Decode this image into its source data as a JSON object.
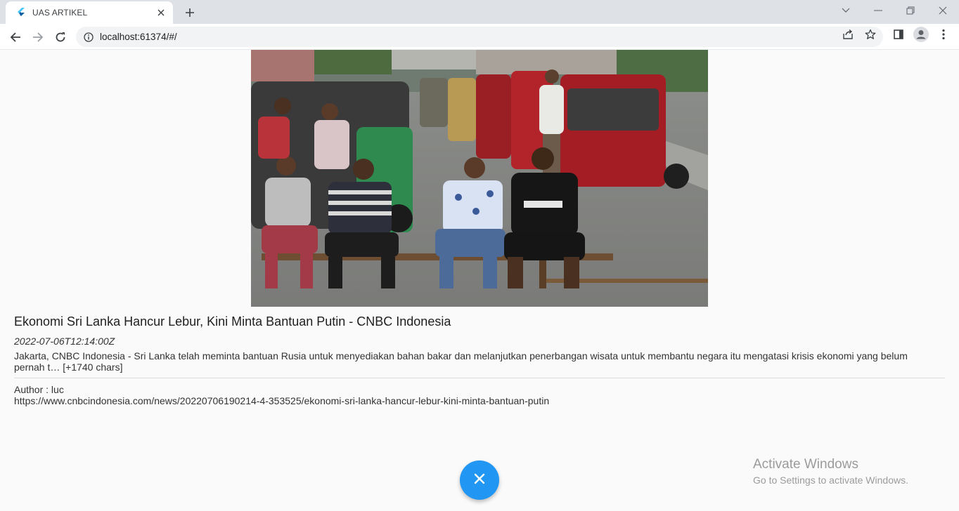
{
  "browser": {
    "tab_title": "UAS ARTIKEL",
    "url": "localhost:61374/#/"
  },
  "article": {
    "title": "Ekonomi Sri Lanka Hancur Lebur, Kini Minta Bantuan Putin - CNBC Indonesia",
    "published_at": "2022-07-06T12:14:00Z",
    "description": "Jakarta, CNBC Indonesia - Sri Lanka telah meminta bantuan Rusia untuk menyediakan bahan bakar dan melanjutkan penerbangan wisata untuk membantu negara itu mengatasi krisis ekonomi yang belum pernah t… [+1740 chars]",
    "author": "Author : luc",
    "url": "https://www.cnbcindonesia.com/news/20220706190214-4-353525/ekonomi-sri-lanka-hancur-lebur-kini-minta-bantuan-putin",
    "image_icon": "news-photo-men-sitting-on-bench-with-tuk-tuks"
  },
  "fab": {
    "icon": "close-icon",
    "color": "#2196f3"
  },
  "watermark": {
    "title": "Activate Windows",
    "subtitle": "Go to Settings to activate Windows."
  }
}
